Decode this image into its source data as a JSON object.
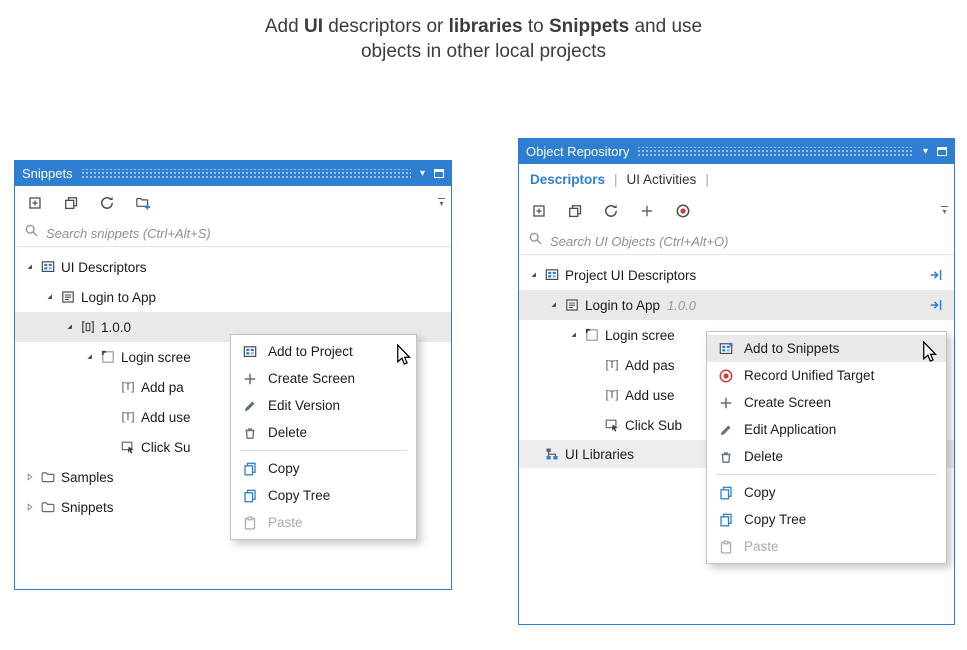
{
  "heading": {
    "p1": "Add ",
    "b1": "UI",
    "p2": " descriptors or ",
    "b2": "libraries",
    "p3": " to ",
    "b3": "Snippets",
    "p4": " and use",
    "line2": "objects in other local projects"
  },
  "icons": {
    "chevron_down": "▾"
  },
  "colors": {
    "accent_blue": "#2e7ed2",
    "selection_gray": "#e9e9e9",
    "record_red": "#d23b3b"
  },
  "snippets": {
    "title": "Snippets",
    "search_placeholder": "Search snippets (Ctrl+Alt+S)",
    "tree": [
      {
        "label": "UI Descriptors"
      },
      {
        "label": "Login to App"
      },
      {
        "label": "1.0.0"
      },
      {
        "label": "Login scree"
      },
      {
        "label": "Add pa"
      },
      {
        "label": "Add use"
      },
      {
        "label": "Click Su"
      },
      {
        "label": "Samples"
      },
      {
        "label": "Snippets"
      }
    ],
    "menu": {
      "items": [
        {
          "label": "Add to Project"
        },
        {
          "label": "Create Screen"
        },
        {
          "label": "Edit Version"
        },
        {
          "label": "Delete"
        },
        {
          "label": "Copy"
        },
        {
          "label": "Copy Tree"
        },
        {
          "label": "Paste"
        }
      ]
    }
  },
  "repository": {
    "title": "Object Repository",
    "tabs": [
      {
        "label": "Descriptors"
      },
      {
        "label": "UI Activities"
      }
    ],
    "tab_separator": "|",
    "search_placeholder": "Search UI Objects (Ctrl+Alt+O)",
    "tree": [
      {
        "label": "Project UI Descriptors"
      },
      {
        "label": "Login to App",
        "suffix": "1.0.0"
      },
      {
        "label": "Login scree"
      },
      {
        "label": "Add pas"
      },
      {
        "label": "Add use"
      },
      {
        "label": "Click Sub"
      },
      {
        "label": "UI Libraries"
      }
    ],
    "menu": {
      "items": [
        {
          "label": "Add to Snippets"
        },
        {
          "label": "Record Unified Target"
        },
        {
          "label": "Create Screen"
        },
        {
          "label": "Edit Application"
        },
        {
          "label": "Delete"
        },
        {
          "label": "Copy"
        },
        {
          "label": "Copy Tree"
        },
        {
          "label": "Paste"
        }
      ]
    }
  }
}
